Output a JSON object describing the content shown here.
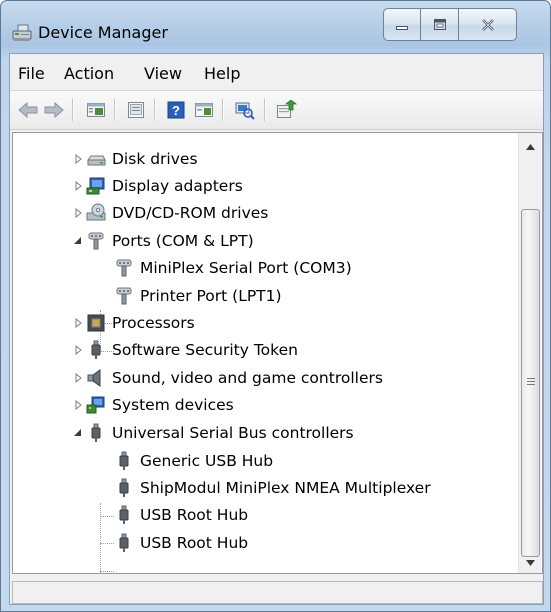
{
  "window": {
    "title": "Device Manager"
  },
  "caption_buttons": {
    "minimize": "minimize-icon",
    "maximize": "maximize-icon",
    "close": "close-icon"
  },
  "menubar": {
    "items": [
      "File",
      "Action",
      "View",
      "Help"
    ]
  },
  "toolbar": {
    "buttons": [
      "back-icon",
      "forward-icon",
      "properties-pane-icon",
      "properties-sheet-icon",
      "help-icon",
      "show-hide-icon",
      "scan-hardware-icon",
      "update-driver-icon"
    ]
  },
  "tree": {
    "nodes": [
      {
        "label": "Disk drives",
        "expanded": false,
        "icon": "disk-drive-icon"
      },
      {
        "label": "Display adapters",
        "expanded": false,
        "icon": "display-adapter-icon"
      },
      {
        "label": "DVD/CD-ROM drives",
        "expanded": false,
        "icon": "dvd-drive-icon"
      },
      {
        "label": "Ports (COM & LPT)",
        "expanded": true,
        "icon": "port-icon",
        "children": [
          "MiniPlex Serial Port (COM3)",
          "Printer Port (LPT1)"
        ]
      },
      {
        "label": "Processors",
        "expanded": false,
        "icon": "processor-icon"
      },
      {
        "label": "Software Security Token",
        "expanded": false,
        "icon": "usb-plug-icon"
      },
      {
        "label": "Sound, video and game controllers",
        "expanded": false,
        "icon": "speaker-icon"
      },
      {
        "label": "System devices",
        "expanded": false,
        "icon": "system-device-icon"
      },
      {
        "label": "Universal Serial Bus controllers",
        "expanded": true,
        "icon": "usb-plug-icon",
        "children": [
          "Generic USB Hub",
          "ShipModul MiniPlex NMEA Multiplexer",
          "USB Root Hub",
          "USB Root Hub"
        ]
      }
    ]
  }
}
